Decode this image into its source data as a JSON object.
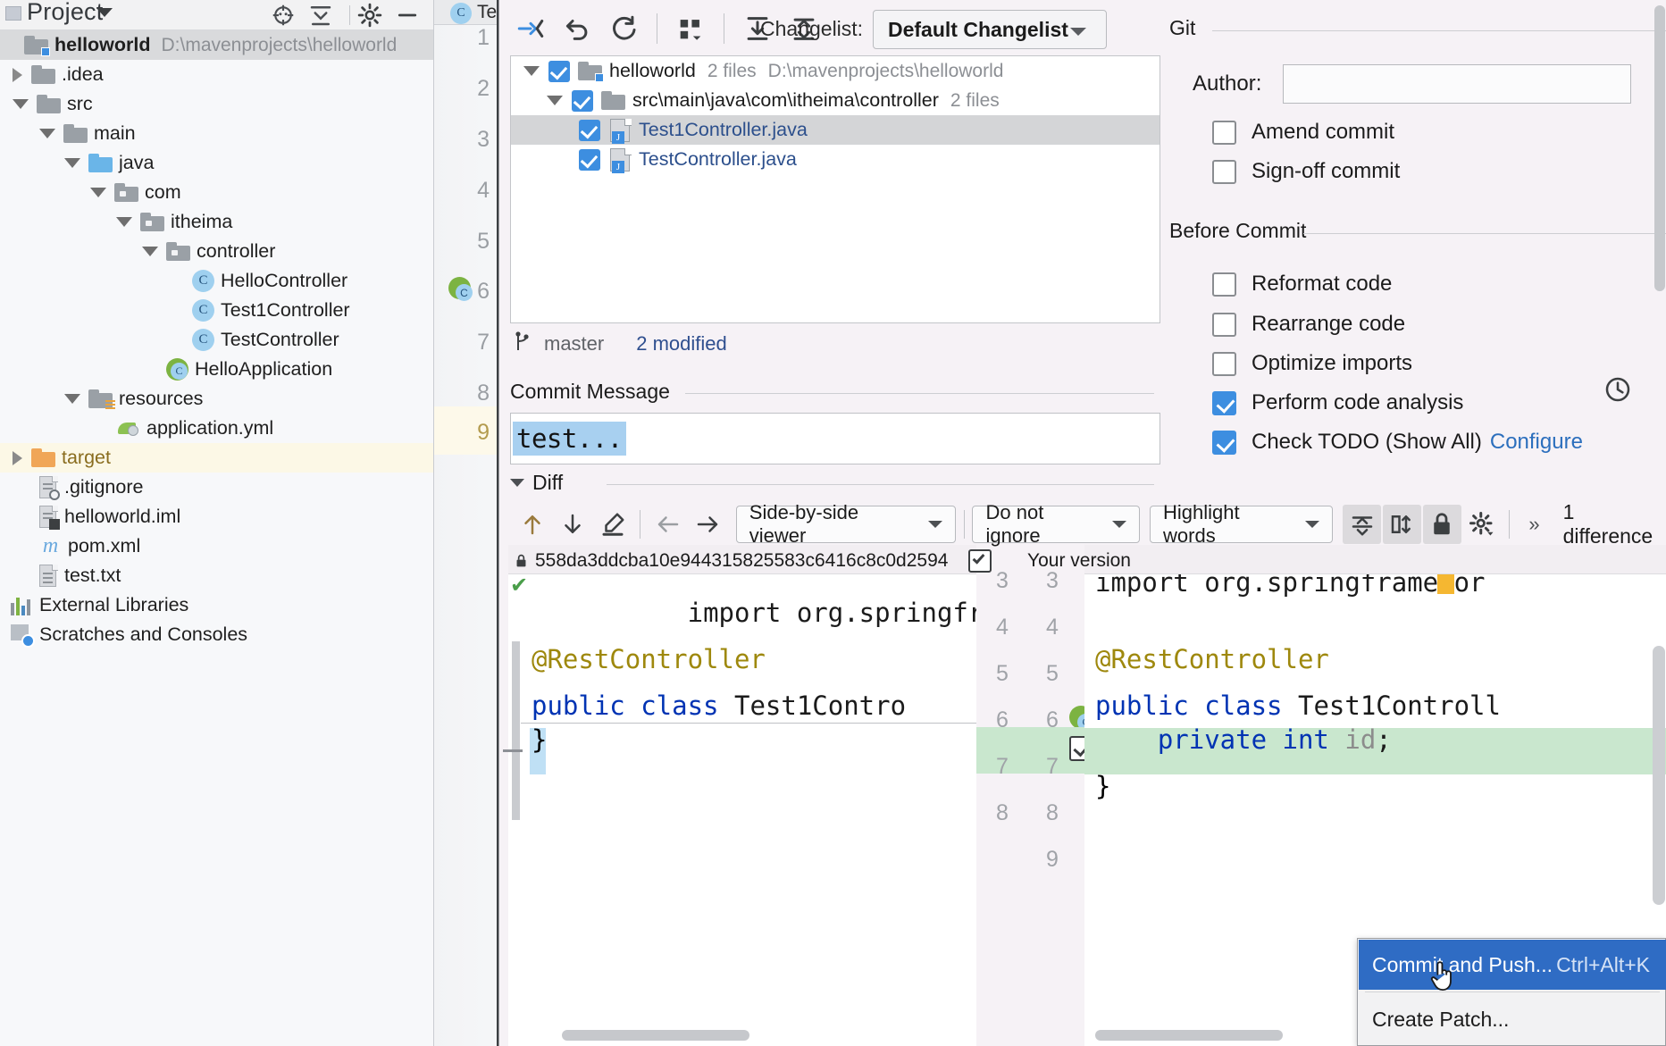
{
  "project_panel": {
    "title": "Project",
    "icons": [
      "target-locate-icon",
      "collapse-all-icon",
      "settings-gear-icon",
      "minimize-icon"
    ],
    "tree": [
      {
        "label": "helloworld",
        "path": "D:\\mavenprojects\\helloworld",
        "icon": "module-folder-icon",
        "indent": 0,
        "arrow": "none",
        "bold": true,
        "selected": true
      },
      {
        "label": ".idea",
        "icon": "folder-icon",
        "indent": 1,
        "arrow": "right"
      },
      {
        "label": "src",
        "icon": "folder-icon",
        "indent": 1,
        "arrow": "down"
      },
      {
        "label": "main",
        "icon": "folder-icon",
        "indent": 2,
        "arrow": "down"
      },
      {
        "label": "java",
        "icon": "source-folder-icon",
        "indent": 3,
        "arrow": "down"
      },
      {
        "label": "com",
        "icon": "package-folder-icon",
        "indent": 4,
        "arrow": "down"
      },
      {
        "label": "itheima",
        "icon": "package-folder-icon",
        "indent": 5,
        "arrow": "down"
      },
      {
        "label": "controller",
        "icon": "package-folder-icon",
        "indent": 6,
        "arrow": "down"
      },
      {
        "label": "HelloController",
        "icon": "java-class-icon",
        "indent": 7,
        "arrow": "none"
      },
      {
        "label": "Test1Controller",
        "icon": "java-class-icon",
        "indent": 7,
        "arrow": "none"
      },
      {
        "label": "TestController",
        "icon": "java-class-icon",
        "indent": 7,
        "arrow": "none"
      },
      {
        "label": "HelloApplication",
        "icon": "spring-boot-class-icon",
        "indent": 6,
        "arrow": "none"
      },
      {
        "label": "resources",
        "icon": "resources-folder-icon",
        "indent": 3,
        "arrow": "down"
      },
      {
        "label": "application.yml",
        "icon": "spring-yaml-icon",
        "indent": 4,
        "arrow": "none"
      },
      {
        "label": "target",
        "icon": "excluded-folder-icon",
        "indent": 1,
        "arrow": "right",
        "highlight": true
      },
      {
        "label": ".gitignore",
        "icon": "gitignore-file-icon",
        "indent": 2,
        "arrow": "none"
      },
      {
        "label": "helloworld.iml",
        "icon": "iml-file-icon",
        "indent": 2,
        "arrow": "none"
      },
      {
        "label": "pom.xml",
        "icon": "maven-file-icon",
        "indent": 2,
        "arrow": "none"
      },
      {
        "label": "test.txt",
        "icon": "text-file-icon",
        "indent": 2,
        "arrow": "none"
      },
      {
        "label": "External Libraries",
        "icon": "libraries-icon",
        "indent": 0,
        "arrow": "none"
      },
      {
        "label": "Scratches and Consoles",
        "icon": "scratches-icon",
        "indent": 0,
        "arrow": "none"
      }
    ]
  },
  "editor": {
    "tab_label": "Te",
    "tab_icon": "java-class-icon",
    "line_numbers": [
      "1",
      "2",
      "3",
      "4",
      "5",
      "6",
      "7",
      "8",
      "9"
    ],
    "run_marker_line": "6"
  },
  "dialog": {
    "toolbar_icons": [
      "show-diff-icon",
      "revert-icon",
      "refresh-icon",
      "group-by-icon",
      "expand-all-icon",
      "collapse-all-icon"
    ],
    "changelist_label": "Changelist:",
    "changelist_value": "Default Changelist",
    "changes": [
      {
        "label": "helloworld",
        "meta": "2 files",
        "path": "D:\\mavenprojects\\helloworld",
        "icon": "module-folder-icon",
        "indent": 0,
        "arrow": "down",
        "checked": true
      },
      {
        "label": "src\\main\\java\\com\\itheima\\controller",
        "meta": "2 files",
        "icon": "folder-icon",
        "indent": 1,
        "arrow": "down",
        "checked": true
      },
      {
        "label": "Test1Controller.java",
        "icon": "java-file-icon",
        "indent": 2,
        "arrow": "none",
        "checked": true,
        "selected": true
      },
      {
        "label": "TestController.java",
        "icon": "java-file-icon",
        "indent": 2,
        "arrow": "none",
        "checked": true
      }
    ],
    "branch_icon": "git-branch-icon",
    "branch_name": "master",
    "modified_count": "2 modified",
    "commit_message_label": "Commit Message",
    "commit_message_value": "test...",
    "history_icon": "clock-history-icon",
    "diff_section_label": "Diff"
  },
  "diff_toolbar": {
    "prev_diff_icon": "arrow-up-icon",
    "next_diff_icon": "arrow-down-icon",
    "edit_icon": "pencil-edit-icon",
    "back_icon": "arrow-left-icon",
    "forward_icon": "arrow-right-icon",
    "viewer_mode": "Side-by-side viewer",
    "whitespace_mode": "Do not ignore",
    "highlight_mode": "Highlight words",
    "collapse_unchanged_icon": "collapse-unchanged-icon",
    "sync-scroll_icon": "synchronize-scroll-icon",
    "readonly_icon": "lock-icon",
    "settings_icon": "gear-icon",
    "overflow_icon": "chevrons-right-icon",
    "difference_count": "1 difference"
  },
  "diff": {
    "left_title": "558da3ddcba10e944315825583c6416c8c0d2594",
    "left_lock_icon": "lock-icon",
    "right_title": "Your version",
    "right_title_check_icon": "checkbox-checked-icon",
    "left_lines": [
      {
        "text": "import org.springframewo",
        "type": "context",
        "check": true
      },
      {
        "text": "",
        "type": "context"
      },
      {
        "text": "@RestController",
        "type": "annotation"
      },
      {
        "text": "public class Test1Contro",
        "type": "code"
      },
      {
        "text": "}",
        "type": "deleted-marker"
      }
    ],
    "right_lines": [
      {
        "text": "import org.springframewor",
        "type": "context"
      },
      {
        "text": "",
        "type": "context"
      },
      {
        "text": "@RestController",
        "type": "annotation"
      },
      {
        "text": "public class Test1Controll",
        "type": "code"
      },
      {
        "text": "    private int id;",
        "type": "added"
      },
      {
        "text": "}",
        "type": "context"
      }
    ],
    "left_gutter_numbers": [
      "3",
      "4",
      "5",
      "6",
      "7",
      "8"
    ],
    "right_gutter_numbers": [
      "3",
      "4",
      "5",
      "6",
      "7",
      "8",
      "9"
    ],
    "accept_change_icon": "accept-change-checkbox",
    "run_gutter_icon": "spring-bean-icon"
  },
  "git_panel": {
    "section_label": "Git",
    "author_label": "Author:",
    "author_value": "",
    "options": [
      {
        "label": "Amend commit",
        "checked": false
      },
      {
        "label": "Sign-off commit",
        "checked": false
      }
    ],
    "before_commit_label": "Before Commit",
    "before_commit_options": [
      {
        "label": "Reformat code",
        "checked": false
      },
      {
        "label": "Rearrange code",
        "checked": false
      },
      {
        "label": "Optimize imports",
        "checked": false
      },
      {
        "label": "Perform code analysis",
        "checked": true
      },
      {
        "label": "Check TODO (Show All)",
        "checked": true,
        "link": "Configure"
      }
    ]
  },
  "context_menu": {
    "items": [
      {
        "label": "Commit and Push...",
        "shortcut": "Ctrl+Alt+K",
        "highlighted": true
      },
      {
        "label": "Create Patch...",
        "shortcut": "",
        "highlighted": false
      }
    ]
  },
  "colors": {
    "accent_blue": "#3d8ee0",
    "menu_highlight": "#2f6cc4",
    "added_green": "#c9e7ce",
    "selection_blue": "#a8d0f0",
    "dialog_bg": "#f6f2f6"
  }
}
